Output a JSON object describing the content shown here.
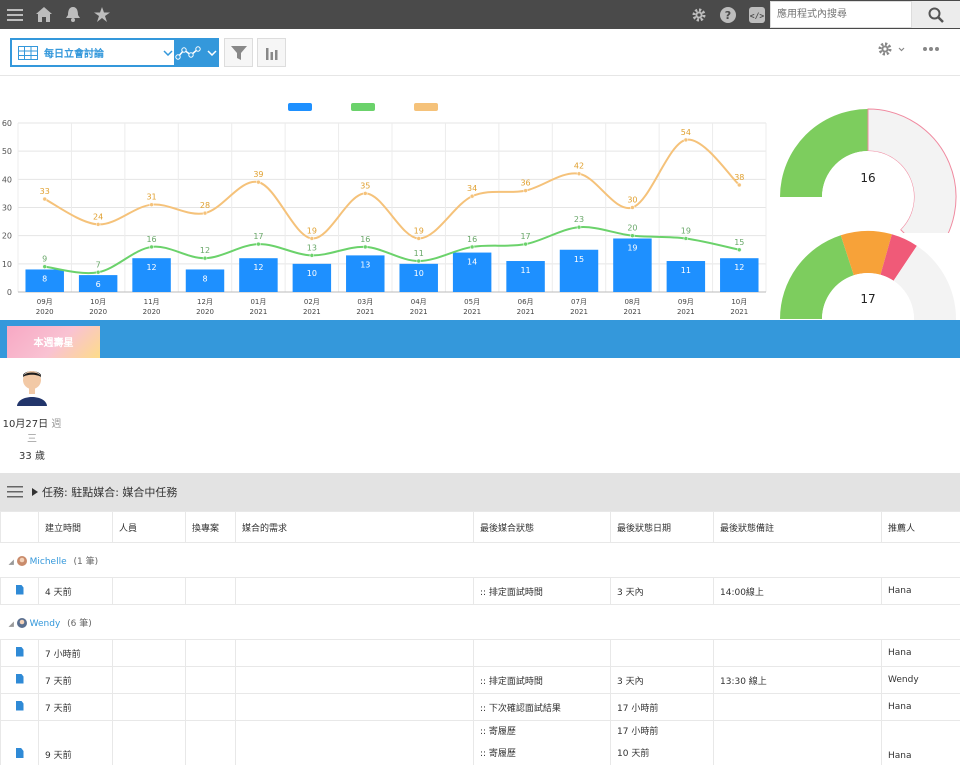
{
  "topbar": {
    "search_placeholder": "應用程式內搜尋",
    "icons": [
      "menu-icon",
      "home-icon",
      "bell-icon",
      "star-icon",
      "gear-icon",
      "help-icon",
      "code-icon",
      "search-icon"
    ]
  },
  "toolbar": {
    "view_name": "每日立會討論"
  },
  "chart_data": [
    {
      "type": "bar",
      "title": "",
      "legend": [
        "",
        "",
        ""
      ],
      "categories": [
        "09月\n2020",
        "10月\n2020",
        "11月\n2020",
        "12月\n2020",
        "01月\n2021",
        "02月\n2021",
        "03月\n2021",
        "04月\n2021",
        "05月\n2021",
        "06月\n2021",
        "07月\n2021",
        "08月\n2021",
        "09月\n2021",
        "10月\n2021"
      ],
      "ylim": [
        0,
        60
      ],
      "yticks": [
        0,
        10,
        20,
        30,
        40,
        50,
        60
      ],
      "grid": true,
      "legend_position": "top",
      "series": [
        {
          "kind": "bar",
          "color": "#1e90ff",
          "values": [
            8,
            6,
            12,
            8,
            12,
            10,
            13,
            10,
            14,
            11,
            15,
            19,
            11,
            12
          ]
        },
        {
          "kind": "line",
          "color": "#6bd26b",
          "values": [
            9,
            7,
            16,
            12,
            17,
            13,
            16,
            11,
            16,
            17,
            23,
            20,
            19,
            15
          ]
        },
        {
          "kind": "line",
          "color": "#f5c27a",
          "values": [
            33,
            24,
            31,
            28,
            39,
            19,
            35,
            19,
            34,
            36,
            42,
            30,
            54,
            38
          ]
        }
      ]
    },
    {
      "type": "gauge",
      "value": 16,
      "colors": [
        "#7dcd5e",
        "#f3f3f3"
      ]
    },
    {
      "type": "gauge",
      "value": 17,
      "colors": [
        "#7dcd5e",
        "#f7a239",
        "#f05a78",
        "#f3f3f3"
      ]
    }
  ],
  "star": {
    "tab_label": "本週壽星",
    "name": "",
    "date": "10月27日",
    "weekday": "週三",
    "age": "33 歲"
  },
  "tasks": {
    "title": "任務: 駐點媒合: 媒合中任務",
    "columns": [
      "建立時間",
      "人員",
      "換專案",
      "媒合的需求",
      "最後媒合狀態",
      "最後狀態日期",
      "最後狀態備註",
      "推薦人"
    ],
    "groups": [
      {
        "name": "Michelle",
        "count": "(1 筆)",
        "rows": [
          {
            "created": "4 天前",
            "person": "",
            "switch": "",
            "req": "",
            "status": ":: 排定面試時間",
            "date": "3 天內",
            "note": "14:00線上",
            "ref": "Hana"
          }
        ]
      },
      {
        "name": "Wendy",
        "count": "(6 筆)",
        "rows": [
          {
            "created": "7 小時前",
            "person": "",
            "switch": "",
            "req": "",
            "status": "",
            "date": "",
            "note": "",
            "ref": "Hana"
          },
          {
            "created": "7 天前",
            "person": "",
            "switch": "",
            "req": "",
            "status": ":: 排定面試時間",
            "date": "3 天內",
            "note": "13:30 線上",
            "ref": "Wendy"
          },
          {
            "created": "7 天前",
            "person": "",
            "switch": "",
            "req": "",
            "status": ":: 下次確認面試結果",
            "date": "17 小時前",
            "note": "",
            "ref": "Hana"
          },
          {
            "created": "9 天前",
            "person": "",
            "switch": "",
            "req": "",
            "status": ":: 寄履歷",
            "date": "17 小時前",
            "status2": ":: 寄履歷",
            "date2": "10 天前",
            "note": "",
            "ref": "Hana"
          }
        ]
      }
    ]
  }
}
